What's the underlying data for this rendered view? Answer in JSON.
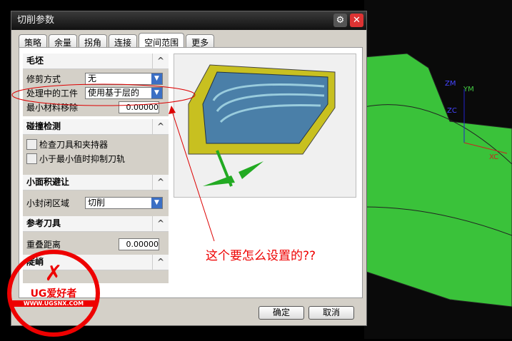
{
  "dialog": {
    "title": "切削参数",
    "tabs": [
      "策略",
      "余量",
      "拐角",
      "连接",
      "空间范围",
      "更多"
    ],
    "active_tab": "空间范围",
    "sections": {
      "blank": {
        "title": "毛坯",
        "trim_label": "修剪方式",
        "trim_value": "无",
        "ipw_label": "处理中的工件",
        "ipw_value": "使用基于层的",
        "min_remove_label": "最小材料移除",
        "min_remove_value": "0.00000"
      },
      "collision": {
        "title": "碰撞检测",
        "check1": "检查刀具和夹持器",
        "check2": "小于最小值时抑制刀轨"
      },
      "small_area": {
        "title": "小面积避让",
        "label": "小封闭区域",
        "value": "切削"
      },
      "ref_tool": {
        "title": "参考刀具",
        "overlap_label": "重叠距离",
        "overlap_value": "0.00000"
      },
      "steep": {
        "title": "陡峭"
      }
    },
    "ok": "确定",
    "cancel": "取消"
  },
  "annotation": "这个要怎么设置的??",
  "axes": {
    "zm": "ZM",
    "ym": "YM",
    "zc": "ZC",
    "xc": "XC"
  },
  "watermark": {
    "brand": "UG爱好者",
    "url": "WWW.UGSNX.COM"
  }
}
